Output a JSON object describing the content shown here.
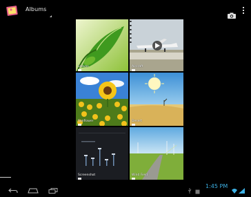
{
  "action_bar": {
    "title": "Albums",
    "camera_icon": "camera-icon",
    "overflow_icon": "overflow-menu-icon",
    "app_icon": "gallery-app-icon"
  },
  "albums": [
    {
      "label": "Leaves",
      "icon": "folder-icon"
    },
    {
      "label": "Aircraft",
      "icon": "folder-icon"
    },
    {
      "label": "Sunflower",
      "icon": "folder-icon"
    },
    {
      "label": "Desert",
      "icon": "folder-icon"
    },
    {
      "label": "Screenshot",
      "icon": "folder-icon"
    },
    {
      "label": "Wind Field",
      "icon": "folder-icon"
    }
  ],
  "nav_bar": {
    "back_icon": "back-icon",
    "home_icon": "home-icon",
    "recents_icon": "recent-apps-icon"
  },
  "status": {
    "time": "1:45 PM"
  },
  "colors": {
    "accent": "#3db1e5",
    "background": "#000000"
  }
}
